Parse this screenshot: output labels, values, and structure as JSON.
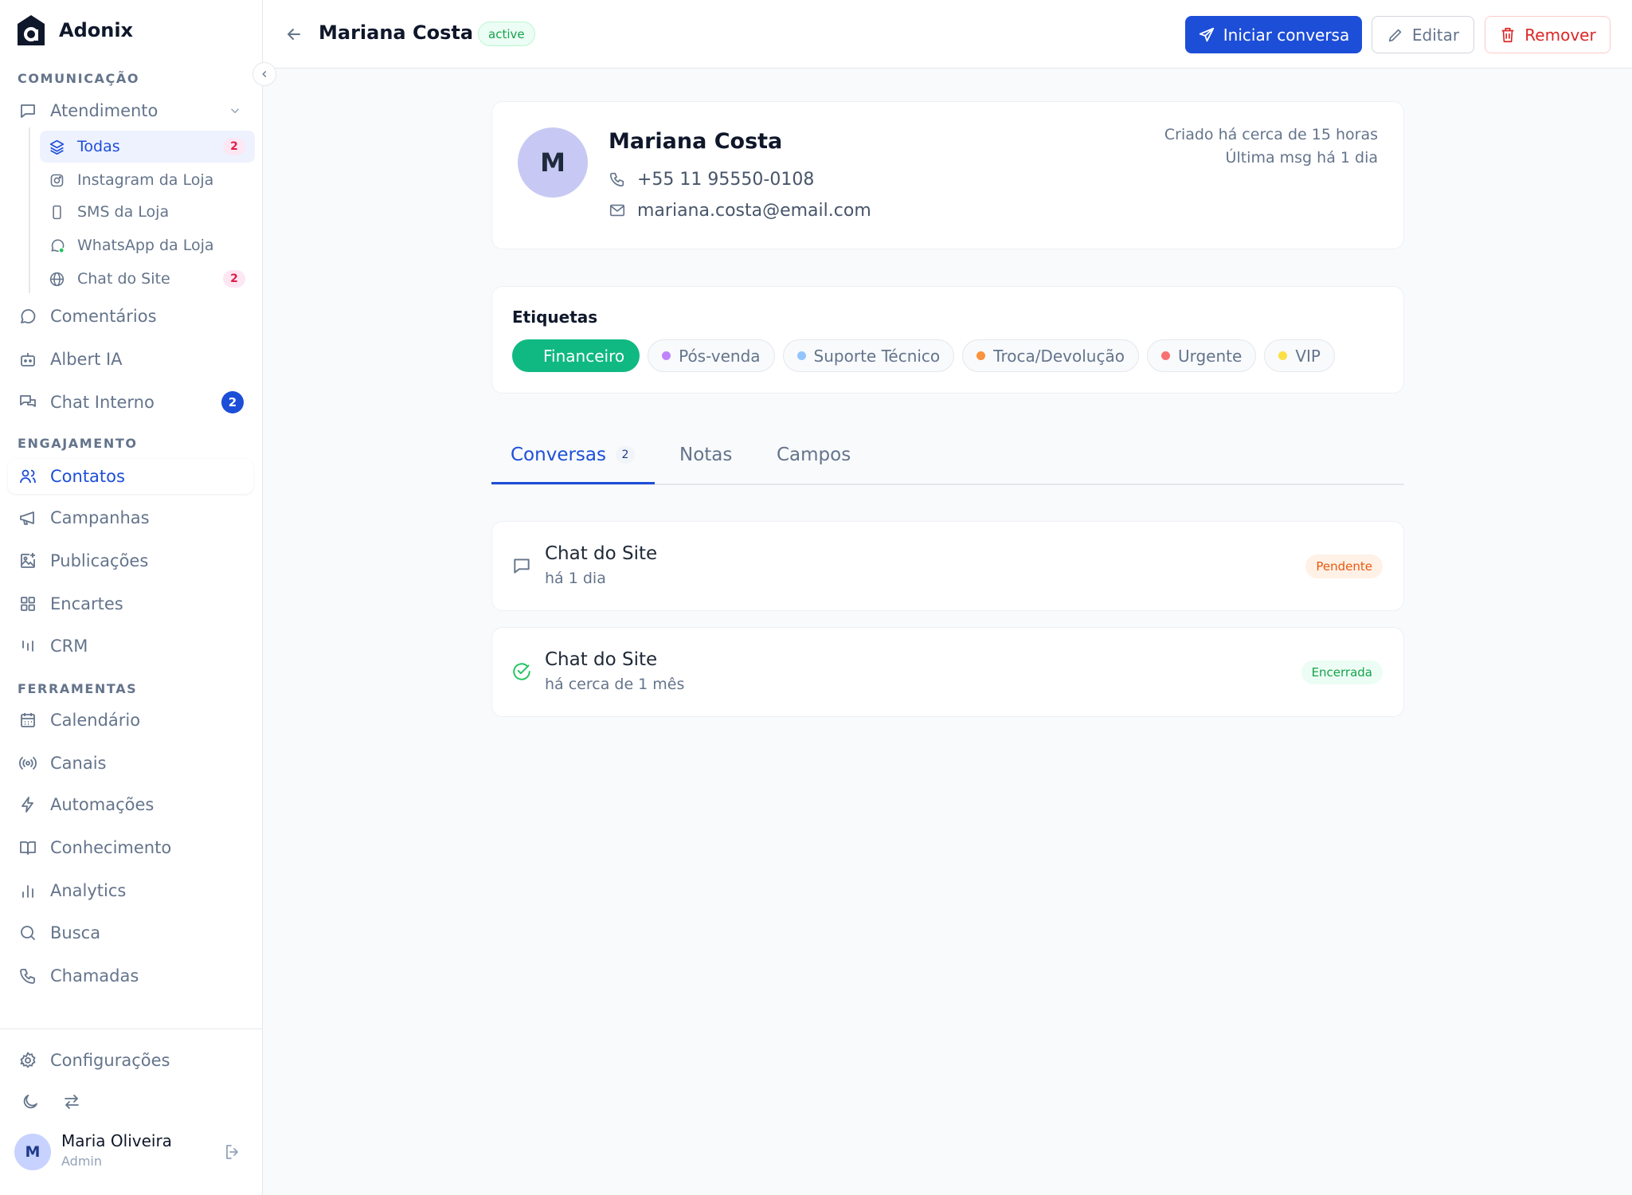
{
  "brand": {
    "name": "Adonix"
  },
  "sidebar": {
    "sections": {
      "comunicacao": "COMUNICAÇÃO",
      "engajamento": "ENGAJAMENTO",
      "ferramentas": "FERRAMENTAS"
    },
    "atendimento": {
      "label": "Atendimento",
      "sub_items": [
        {
          "label": "Todas",
          "badge": "2",
          "icon": "layers-icon",
          "active": true
        },
        {
          "label": "Instagram da Loja",
          "icon": "instagram-icon"
        },
        {
          "label": "SMS da Loja",
          "icon": "phone-device-icon"
        },
        {
          "label": "WhatsApp da Loja",
          "icon": "whatsapp-icon"
        },
        {
          "label": "Chat do Site",
          "badge": "2",
          "icon": "globe-icon"
        }
      ]
    },
    "items": {
      "comentarios": "Comentários",
      "albert": "Albert IA",
      "chat_interno": "Chat Interno",
      "chat_interno_badge": "2",
      "contatos": "Contatos",
      "campanhas": "Campanhas",
      "publicacoes": "Publicações",
      "encartes": "Encartes",
      "crm": "CRM",
      "calendario": "Calendário",
      "canais": "Canais",
      "automacoes": "Automações",
      "conhecimento": "Conhecimento",
      "analytics": "Analytics",
      "busca": "Busca",
      "chamadas": "Chamadas",
      "configuracoes": "Configurações"
    },
    "user": {
      "initial": "M",
      "name": "Maria Oliveira",
      "role": "Admin"
    }
  },
  "header": {
    "title": "Mariana Costa",
    "status": "active",
    "start_chat": "Iniciar conversa",
    "edit": "Editar",
    "remove": "Remover"
  },
  "contact": {
    "initial": "M",
    "name": "Mariana Costa",
    "phone": "+55 11 95550-0108",
    "email": "mariana.costa@email.com",
    "created": "Criado há cerca de 15 horas",
    "last_msg": "Última msg há 1 dia"
  },
  "tags": {
    "title": "Etiquetas",
    "items": [
      {
        "label": "Financeiro",
        "color": "#10b981",
        "selected": true
      },
      {
        "label": "Pós-venda",
        "color": "#c084fc"
      },
      {
        "label": "Suporte Técnico",
        "color": "#93c5fd"
      },
      {
        "label": "Troca/Devolução",
        "color": "#fb923c"
      },
      {
        "label": "Urgente",
        "color": "#f87171"
      },
      {
        "label": "VIP",
        "color": "#fde047"
      }
    ]
  },
  "tabs": {
    "conversas": "Conversas",
    "conversas_count": "2",
    "notas": "Notas",
    "campos": "Campos"
  },
  "conversations": [
    {
      "title": "Chat do Site",
      "time": "há 1 dia",
      "status": "Pendente",
      "icon": "message-square-icon"
    },
    {
      "title": "Chat do Site",
      "time": "há cerca de 1 mês",
      "status": "Encerrada",
      "icon": "check-circle-icon"
    }
  ],
  "colors": {
    "accent": "#1d4ed8",
    "pending_bg": "#fff1e6",
    "pending_text": "#ea580c",
    "closed_bg": "#ecfdf5",
    "closed_text": "#16a34a"
  }
}
